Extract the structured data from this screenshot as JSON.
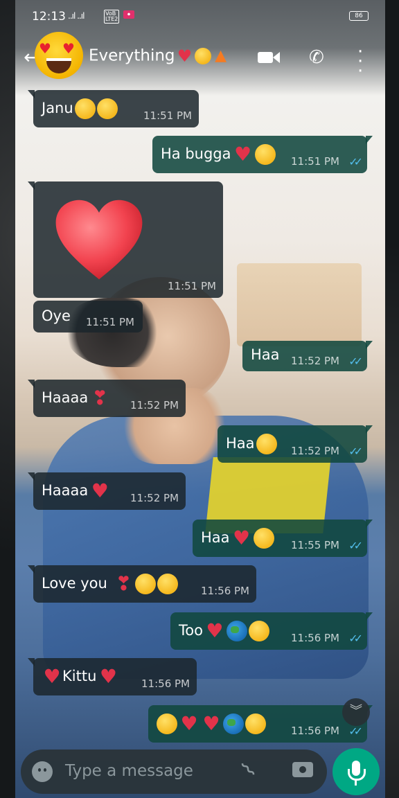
{
  "status_bar": {
    "time": "12:13",
    "signal": "..ıl ..ıl",
    "volte": "VoB LTE2",
    "battery": "86"
  },
  "header": {
    "title": "Everything",
    "title_emojis": [
      "heart",
      "smiling-face-with-hearts",
      "fire"
    ]
  },
  "messages": [
    {
      "dir": "in",
      "text": "Janu",
      "emojis": [
        "face-blowing-kiss",
        "smiling-face-with-hearts"
      ],
      "time": "11:51 PM"
    },
    {
      "dir": "out",
      "text": "Ha bugga",
      "emojis": [
        "heart",
        "heart-eyes"
      ],
      "time": "11:51 PM",
      "read": true
    },
    {
      "dir": "in",
      "text": "",
      "emojis": [
        "big-red-heart"
      ],
      "time": "11:51 PM"
    },
    {
      "dir": "in",
      "text": "Oye",
      "emojis": [],
      "time": "11:51 PM"
    },
    {
      "dir": "out",
      "text": "Haa",
      "emojis": [],
      "time": "11:52 PM",
      "read": true
    },
    {
      "dir": "in",
      "text": "Haaaa",
      "emojis": [
        "heart-exclamation"
      ],
      "time": "11:52 PM"
    },
    {
      "dir": "out",
      "text": "Haa",
      "emojis": [
        "face-with-hand-over-mouth"
      ],
      "time": "11:52 PM",
      "read": true
    },
    {
      "dir": "in",
      "text": "Haaaa",
      "emojis": [
        "beating-heart"
      ],
      "time": "11:52 PM"
    },
    {
      "dir": "out",
      "text": "Haa",
      "emojis": [
        "heart",
        "face-with-hand-over-mouth"
      ],
      "time": "11:55 PM",
      "read": true
    },
    {
      "dir": "in",
      "text": "Love you",
      "emojis": [
        "heart-exclamation",
        "face-blowing-kiss",
        "smiling-face-with-hearts"
      ],
      "time": "11:56 PM"
    },
    {
      "dir": "out",
      "text": "Too",
      "emojis": [
        "heart",
        "globe",
        "face-blowing-kiss"
      ],
      "time": "11:56 PM",
      "read": true
    },
    {
      "dir": "in",
      "text": "Kittu",
      "emojis": [
        "heart",
        "heart"
      ],
      "time": "11:56 PM"
    },
    {
      "dir": "out",
      "text": "",
      "emojis": [
        "face-blowing-kiss",
        "heart",
        "heart",
        "globe",
        "face-blowing-kiss"
      ],
      "time": "11:56 PM",
      "read": true
    }
  ],
  "composer": {
    "placeholder": "Type a message"
  },
  "icons": {
    "back": "back-arrow-icon",
    "video": "video-call-icon",
    "call": "phone-icon",
    "more": "more-vertical-icon",
    "emoji": "emoji-icon",
    "attach": "paperclip-icon",
    "camera": "camera-icon",
    "mic": "microphone-icon",
    "scroll": "chevron-double-down-icon"
  },
  "colors": {
    "incoming_bubble": "#1b262c",
    "outgoing_bubble": "#11483f",
    "read_ticks": "#53bdeb",
    "mic_button": "#00a884"
  }
}
